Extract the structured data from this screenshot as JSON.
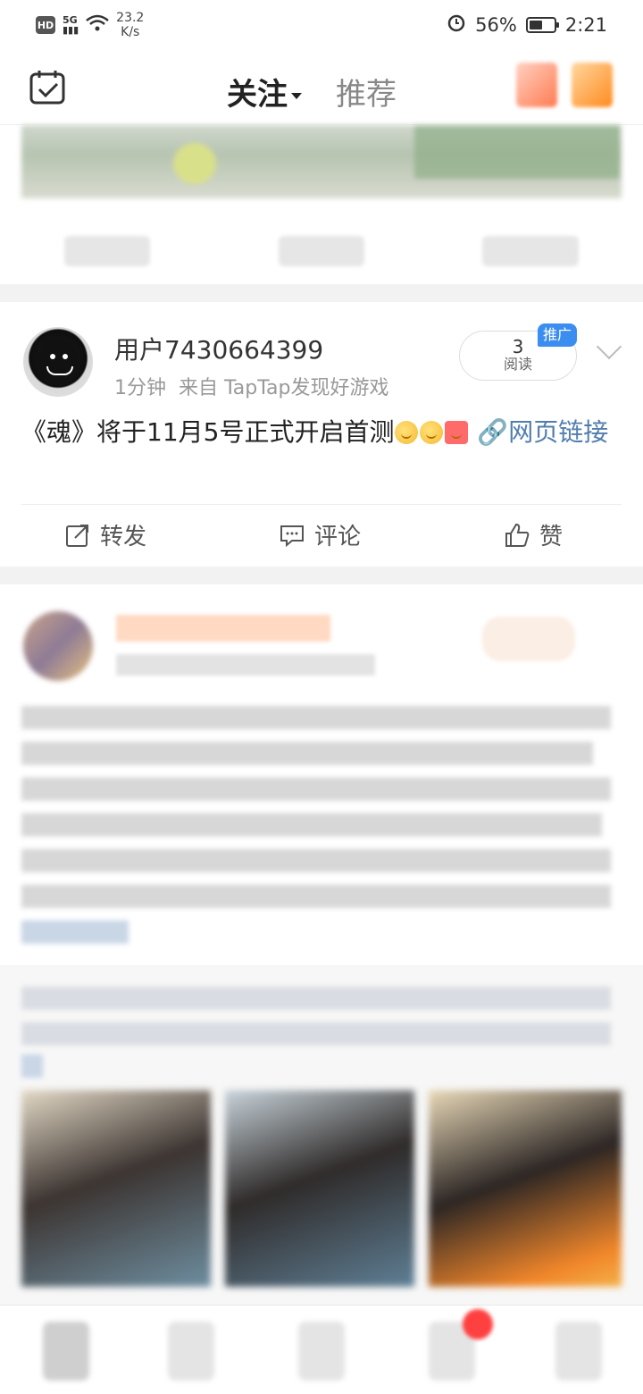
{
  "status_bar": {
    "hd": "HD",
    "net_speed_value": "23.2",
    "net_speed_unit": "K/s",
    "battery": "56%",
    "time": "2:21"
  },
  "nav": {
    "tabs": [
      {
        "label": "关注",
        "active": true
      },
      {
        "label": "推荐",
        "active": false
      }
    ],
    "accent_color": "#ff8200"
  },
  "post": {
    "username": "用户7430664399",
    "time_ago": "1分钟",
    "source": "来自 TapTap发现好游戏",
    "read_count": "3",
    "read_label": "阅读",
    "promo_tag": "推广",
    "text": "《魂》将于11月5号正式开启首测",
    "link_text": "网页链接",
    "actions": {
      "repost": "转发",
      "comment": "评论",
      "like": "赞"
    }
  },
  "colors": {
    "link": "#507daf",
    "promo_tag_bg": "#3b8ef0"
  }
}
